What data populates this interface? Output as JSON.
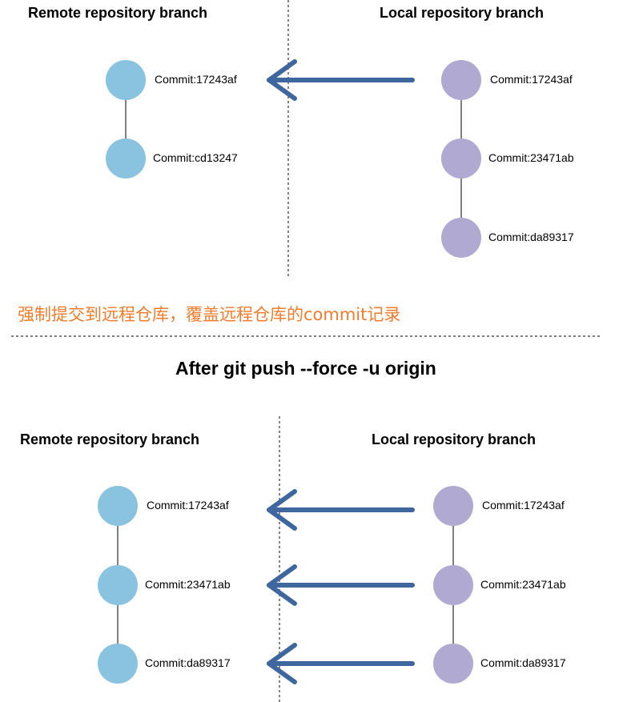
{
  "top": {
    "remote_header": "Remote repository branch",
    "local_header": "Local repository branch",
    "remote_commits": [
      "Commit:17243af",
      "Commit:cd13247"
    ],
    "local_commits": [
      "Commit:17243af",
      "Commit:23471ab",
      "Commit:da89317"
    ]
  },
  "note": "强制提交到远程仓库，覆盖远程仓库的commit记录",
  "after_title": "After git push --force -u origin",
  "bottom": {
    "remote_header": "Remote repository branch",
    "local_header": "Local repository branch",
    "remote_commits": [
      "Commit:17243af",
      "Commit:23471ab",
      "Commit:da89317"
    ],
    "local_commits": [
      "Commit:17243af",
      "Commit:23471ab",
      "Commit:da89317"
    ]
  },
  "colors": {
    "remote_node": "#89c3df",
    "local_node": "#b0a9d1",
    "arrow": "#3d679e",
    "note": "#f07c2c"
  }
}
